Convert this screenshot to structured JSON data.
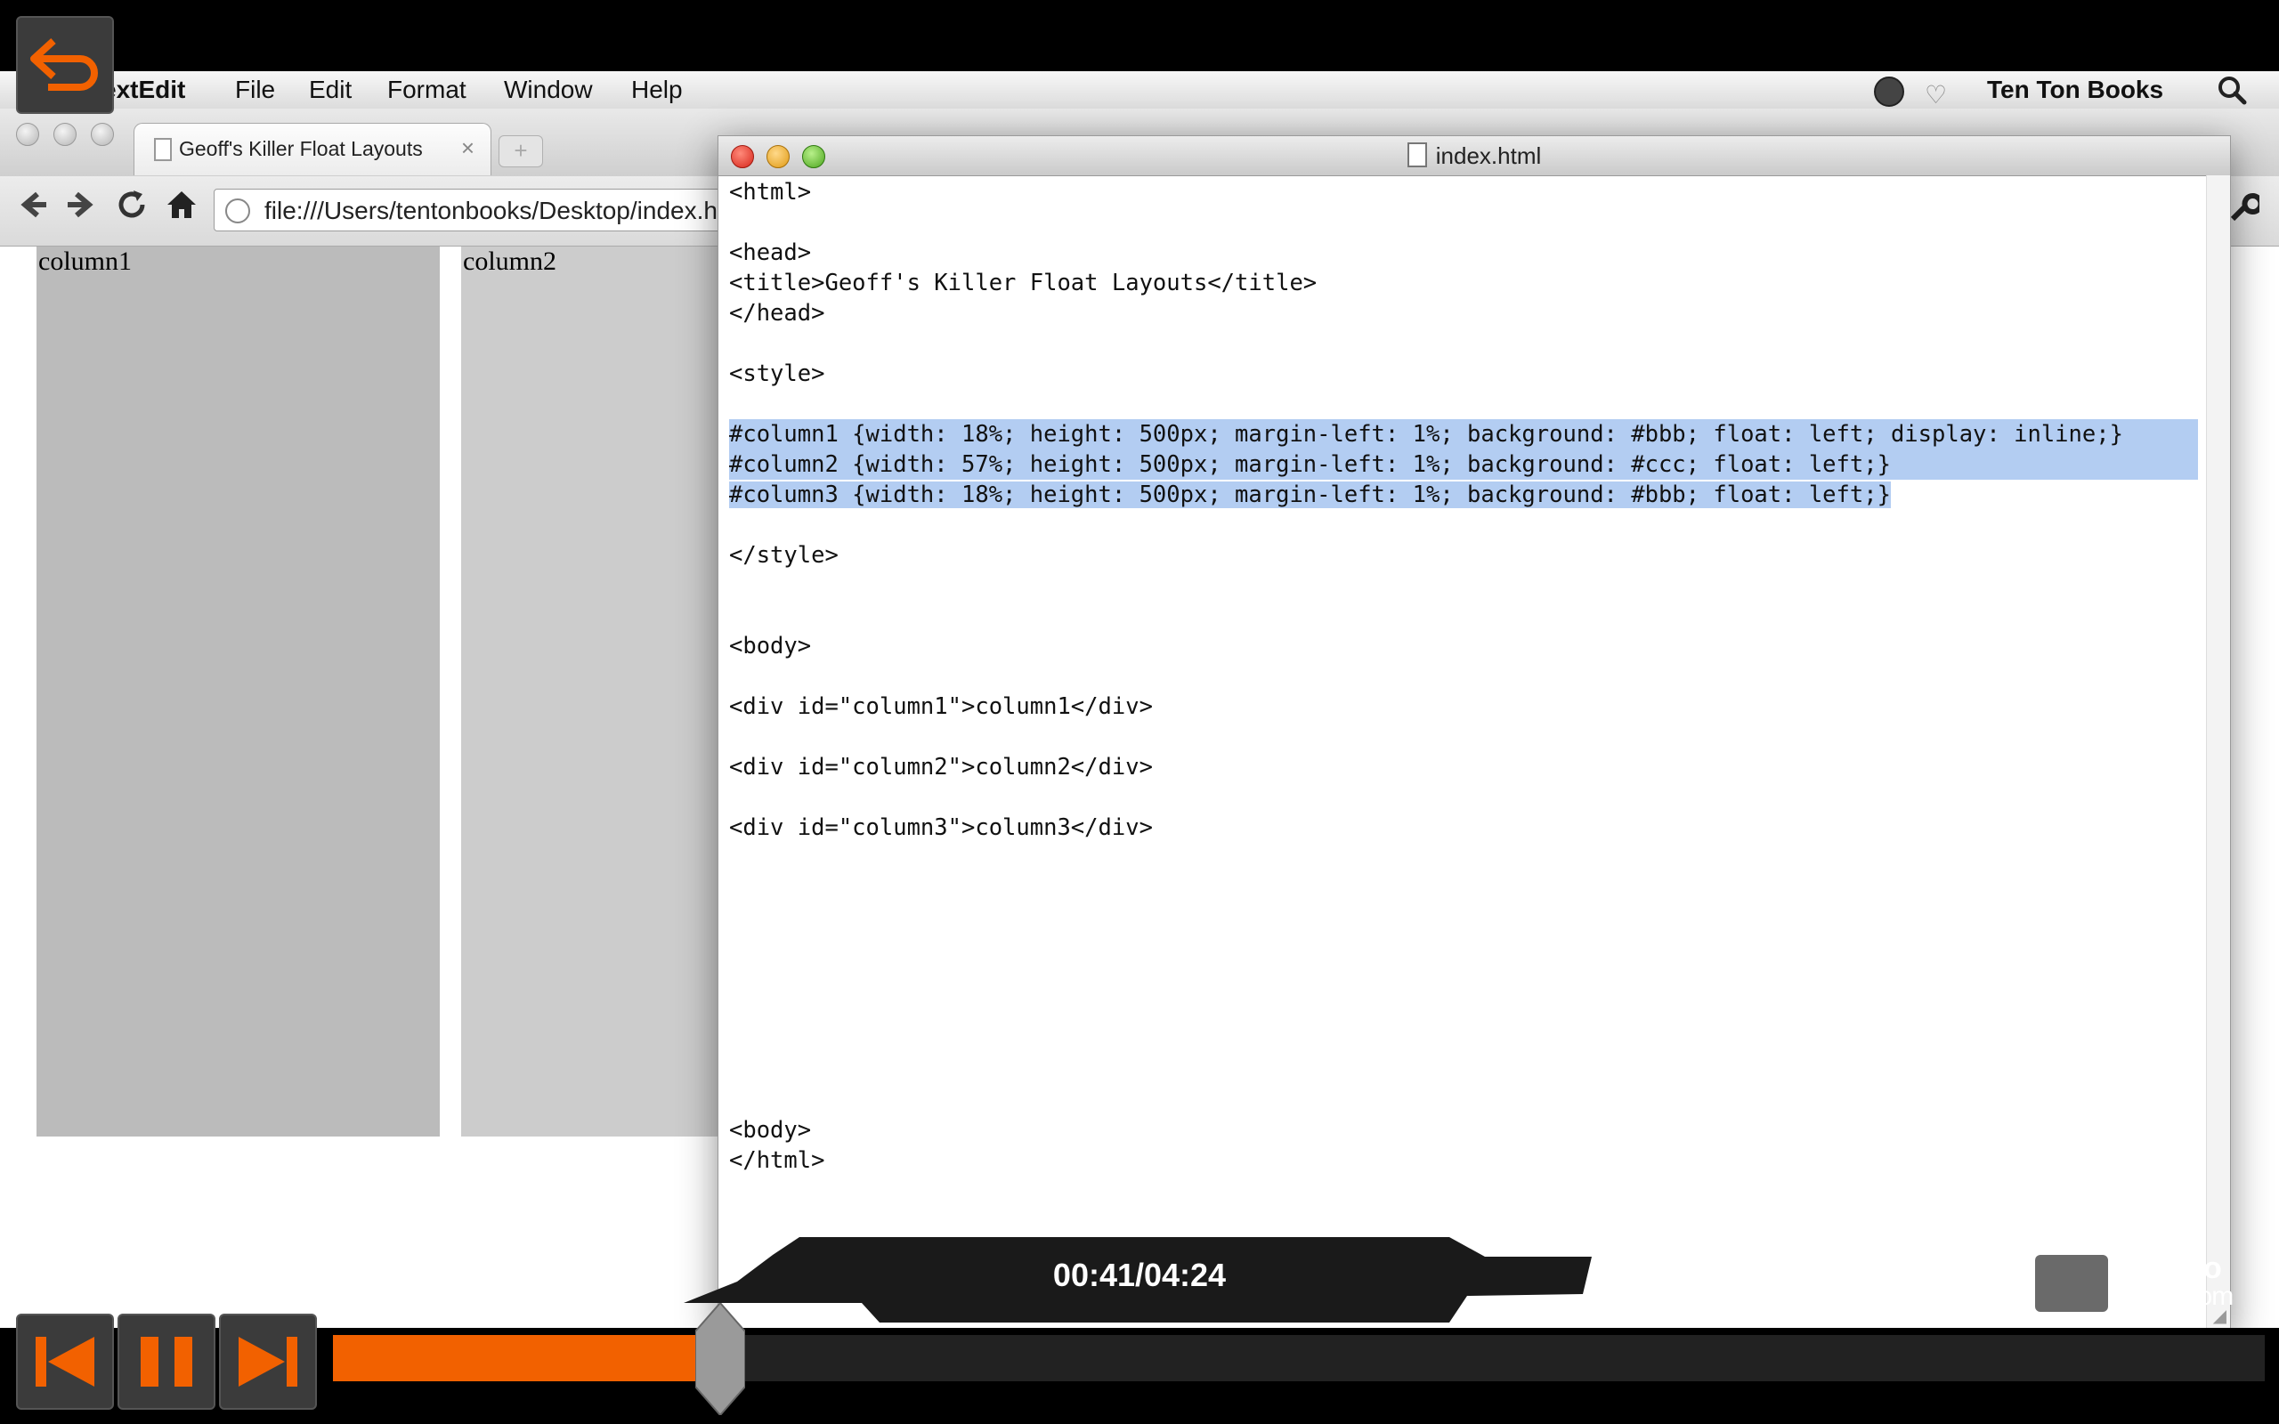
{
  "menubar": {
    "app": "TextEdit",
    "items": [
      "File",
      "Edit",
      "Format",
      "Window",
      "Help"
    ],
    "right_label": "Ten Ton Books"
  },
  "browser": {
    "tab_title": "Geoff's Killer Float Layouts",
    "tab_close": "×",
    "new_tab": "+",
    "url": "file:///Users/tentonbooks/Desktop/index.html",
    "columns": [
      "column1",
      "column2"
    ],
    "column_colors": [
      "#bbbbbb",
      "#cccccc"
    ]
  },
  "editor": {
    "title": "index.html",
    "lines": [
      "<html>",
      "",
      "<head>",
      "<title>Geoff's Killer Float Layouts</title>",
      "</head>",
      "",
      "<style>",
      "",
      "#column1 {width: 18%; height: 500px; margin-left: 1%; background: #bbb; float: left; display: inline;}",
      "#column2 {width: 57%; height: 500px; margin-left: 1%; background: #ccc; float: left;}",
      "#column3 {width: 18%; height: 500px; margin-left: 1%; background: #bbb; float: left;}",
      "",
      "</style>",
      "",
      "",
      "<body>",
      "",
      "<div id=\"column1\">column1</div>",
      "",
      "<div id=\"column2\">column2</div>",
      "",
      "<div id=\"column3\">column3</div>",
      "",
      "",
      "",
      "",
      "",
      "",
      "",
      "",
      "",
      "<body>",
      "</html>"
    ],
    "selected_lines": [
      8,
      9,
      10
    ]
  },
  "player": {
    "timecode": "00:41/04:24",
    "progress": 0.09,
    "logo_line1": "macPro",
    "logo_line2": "Video.com",
    "accent": "#f26100"
  }
}
